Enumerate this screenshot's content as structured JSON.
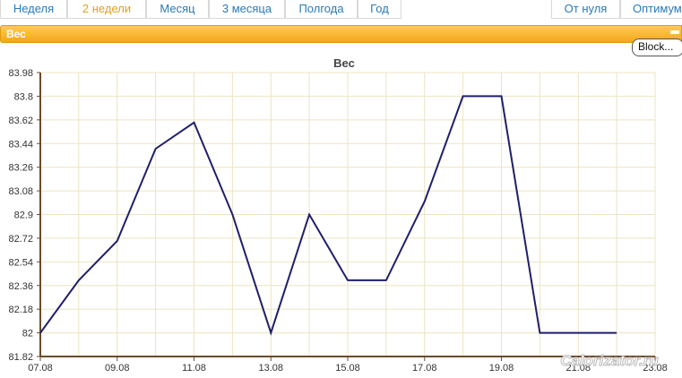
{
  "tabs_left": [
    "Неделя",
    "2 недели",
    "Месяц",
    "3 месяца",
    "Полгода",
    "Год"
  ],
  "tabs_right": [
    "От нуля",
    "Оптимум"
  ],
  "active_tab": "2 недели",
  "panel": {
    "title": "Вес",
    "block_button": "Block..."
  },
  "watermark": "Calorizator.ru",
  "colors": {
    "line": "#1f1f6b",
    "grid": "#ece4c0",
    "axis": "#6b4a2a",
    "panel": "#f4a61a",
    "tab_text": "#2a7ab8",
    "active_tab_text": "#e0a020"
  },
  "chart_data": {
    "type": "line",
    "title": "Вес",
    "xlabel": "",
    "ylabel": "",
    "ylim": [
      81.82,
      83.98
    ],
    "y_ticks": [
      "81.82",
      "82",
      "82.18",
      "82.36",
      "82.54",
      "82.72",
      "82.9",
      "83.08",
      "83.26",
      "83.44",
      "83.62",
      "83.8",
      "83.98"
    ],
    "x_ticks": [
      "07.08",
      "09.08",
      "11.08",
      "13.08",
      "15.08",
      "17.08",
      "19.08",
      "21.08",
      "23.08"
    ],
    "x_domain": [
      "07.08",
      "23.08"
    ],
    "grid": true,
    "series": [
      {
        "x": [
          "07.08",
          "08.08",
          "09.08",
          "10.08",
          "11.08",
          "12.08",
          "13.08",
          "14.08",
          "15.08",
          "16.08",
          "17.08",
          "18.08",
          "19.08",
          "20.08",
          "21.08",
          "22.08"
        ],
        "values": [
          82.0,
          82.4,
          82.7,
          83.4,
          83.6,
          82.9,
          82.0,
          82.9,
          82.4,
          82.4,
          83.0,
          83.8,
          83.8,
          82.0,
          82.0,
          82.0
        ]
      }
    ]
  }
}
